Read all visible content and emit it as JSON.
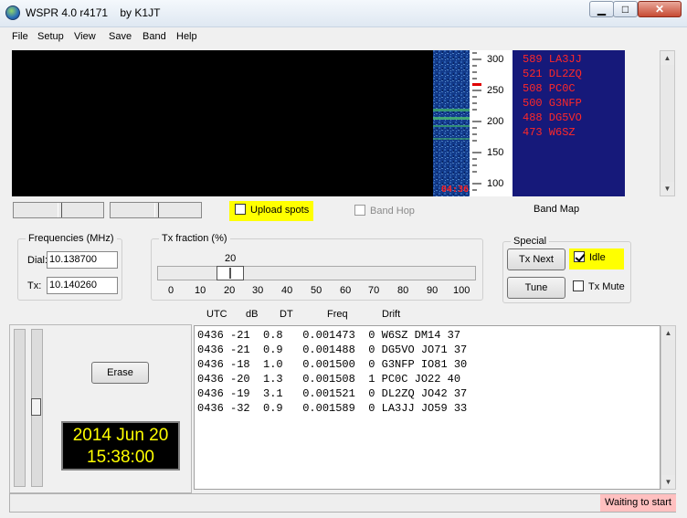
{
  "window": {
    "title": "WSPR 4.0 r4171    by K1JT",
    "minimize": "▁",
    "maximize": "□",
    "close": "✕"
  },
  "menu": [
    "File",
    "Setup",
    "View",
    "Save",
    "Band",
    "Help"
  ],
  "waterfall": {
    "time": "04:36"
  },
  "scale": {
    "ticks": [
      "300",
      "250",
      "200",
      "150",
      "100"
    ]
  },
  "band_map": {
    "lines": [
      "589 LA3JJ",
      "521 DL2ZQ",
      "508 PC0C",
      "500 G3NFP",
      "488 DG5VO",
      "473 W6SZ"
    ],
    "label": "Band Map"
  },
  "controls": {
    "upload_spots": {
      "label": "Upload spots",
      "checked": false
    },
    "band_hop": {
      "label": "Band Hop",
      "checked": false,
      "enabled": false
    }
  },
  "frequencies": {
    "title": "Frequencies (MHz)",
    "dial_label": "Dial:",
    "dial_value": "10.138700",
    "tx_label": "Tx:",
    "tx_value": "10.140260"
  },
  "tx_fraction": {
    "title": "Tx fraction (%)",
    "value": "20",
    "ticks": [
      "0",
      "10",
      "20",
      "30",
      "40",
      "50",
      "60",
      "70",
      "80",
      "90",
      "100"
    ]
  },
  "special": {
    "title": "Special",
    "tx_next": "Tx Next",
    "tune": "Tune",
    "idle": {
      "label": "Idle",
      "checked": true
    },
    "tx_mute": {
      "label": "Tx Mute",
      "checked": false
    }
  },
  "erase_label": "Erase",
  "clock": {
    "date": "2014 Jun 20",
    "time": "15:38:00"
  },
  "decode_headers": [
    "UTC",
    "dB",
    "DT",
    "Freq",
    "Drift"
  ],
  "decodes": [
    "0436 -21  0.8   0.001473  0 W6SZ DM14 37",
    "0436 -21  0.9   0.001488  0 DG5VO JO71 37",
    "0436 -18  1.0   0.001500  0 G3NFP IO81 30",
    "0436 -20  1.3   0.001508  1 PC0C JO22 40",
    "0436 -19  3.1   0.001521  0 DL2ZQ JO42 37",
    "0436 -32  0.9   0.001589  0 LA3JJ JO59 33"
  ],
  "status": "Waiting to start",
  "colors": {
    "band_map_bg": "#16197a",
    "band_map_text": "#ff2828",
    "highlight": "#ffff00",
    "status_bg": "#ffc0c0",
    "clock_text": "#ffff00"
  }
}
